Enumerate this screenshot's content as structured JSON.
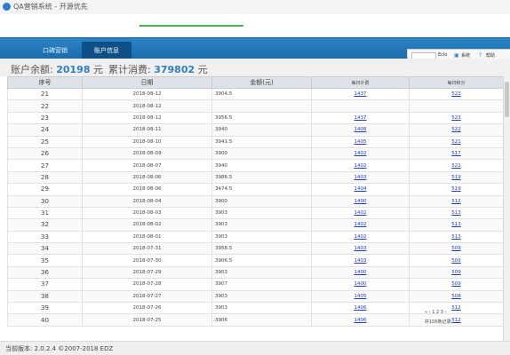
{
  "window": {
    "title": "QA营销系统 - 开源优先"
  },
  "nav": {
    "tabs": [
      {
        "label": "口碑营销"
      },
      {
        "label": "账户信息"
      }
    ]
  },
  "toolbar": {
    "label_1": "Eclo",
    "label_2": "系统",
    "label_3": "帮助"
  },
  "summary": {
    "balance_label": "账户余额:",
    "balance_value": "20198",
    "balance_unit": "元",
    "spent_label": "累计消费:",
    "spent_value": "379802",
    "spent_unit": "元"
  },
  "table": {
    "columns": {
      "seq": "序号",
      "date": "日期",
      "amount": "金额(元)",
      "col_a": "每日计费",
      "col_b": "每日积分"
    },
    "rows": [
      {
        "seq": "21",
        "date": "2018-08-12",
        "amount": "3904.5",
        "a": "1437",
        "b": "523"
      },
      {
        "seq": "22",
        "date": "2018-08-12",
        "amount": "",
        "a": "",
        "b": ""
      },
      {
        "seq": "23",
        "date": "2018-08-12",
        "amount": "3956.5",
        "a": "1437",
        "b": "523"
      },
      {
        "seq": "24",
        "date": "2018-08-11",
        "amount": "3940",
        "a": "1408",
        "b": "522"
      },
      {
        "seq": "25",
        "date": "2018-08-10",
        "amount": "3941.5",
        "a": "1405",
        "b": "521"
      },
      {
        "seq": "26",
        "date": "2018-08-09",
        "amount": "3900",
        "a": "1402",
        "b": "517"
      },
      {
        "seq": "27",
        "date": "2018-08-07",
        "amount": "3940",
        "a": "1402",
        "b": "521"
      },
      {
        "seq": "28",
        "date": "2018-08-06",
        "amount": "3986.5",
        "a": "1403",
        "b": "519"
      },
      {
        "seq": "29",
        "date": "2018-08-06",
        "amount": "3474.5",
        "a": "1404",
        "b": "519"
      },
      {
        "seq": "30",
        "date": "2018-08-04",
        "amount": "3900",
        "a": "1400",
        "b": "512"
      },
      {
        "seq": "31",
        "date": "2018-08-03",
        "amount": "3903",
        "a": "1402",
        "b": "513"
      },
      {
        "seq": "32",
        "date": "2018-08-02",
        "amount": "3903",
        "a": "1402",
        "b": "513"
      },
      {
        "seq": "33",
        "date": "2018-08-01",
        "amount": "3903",
        "a": "1402",
        "b": "513"
      },
      {
        "seq": "34",
        "date": "2018-07-31",
        "amount": "3958.5",
        "a": "1403",
        "b": "509"
      },
      {
        "seq": "35",
        "date": "2018-07-30",
        "amount": "3906.5",
        "a": "1403",
        "b": "509"
      },
      {
        "seq": "36",
        "date": "2018-07-29",
        "amount": "3903",
        "a": "1400",
        "b": "509"
      },
      {
        "seq": "37",
        "date": "2018-07-28",
        "amount": "3907",
        "a": "1400",
        "b": "509"
      },
      {
        "seq": "38",
        "date": "2018-07-27",
        "amount": "3903",
        "a": "1405",
        "b": "508"
      },
      {
        "seq": "39",
        "date": "2018-07-26",
        "amount": "3903",
        "a": "1406",
        "b": "512"
      },
      {
        "seq": "40",
        "date": "2018-07-25",
        "amount": "3906",
        "a": "1406",
        "b": "512"
      }
    ]
  },
  "pager": {
    "info": "共100条记录",
    "nav": "« ‹ 1 2 3 ›"
  },
  "status": {
    "version": "当前版本: 2.0.2.4  ©2007-2018 EDZ"
  },
  "colors": {
    "nav_bg": "#1f73b3",
    "accent": "#2e7fc0",
    "link": "#1f3fbf"
  }
}
